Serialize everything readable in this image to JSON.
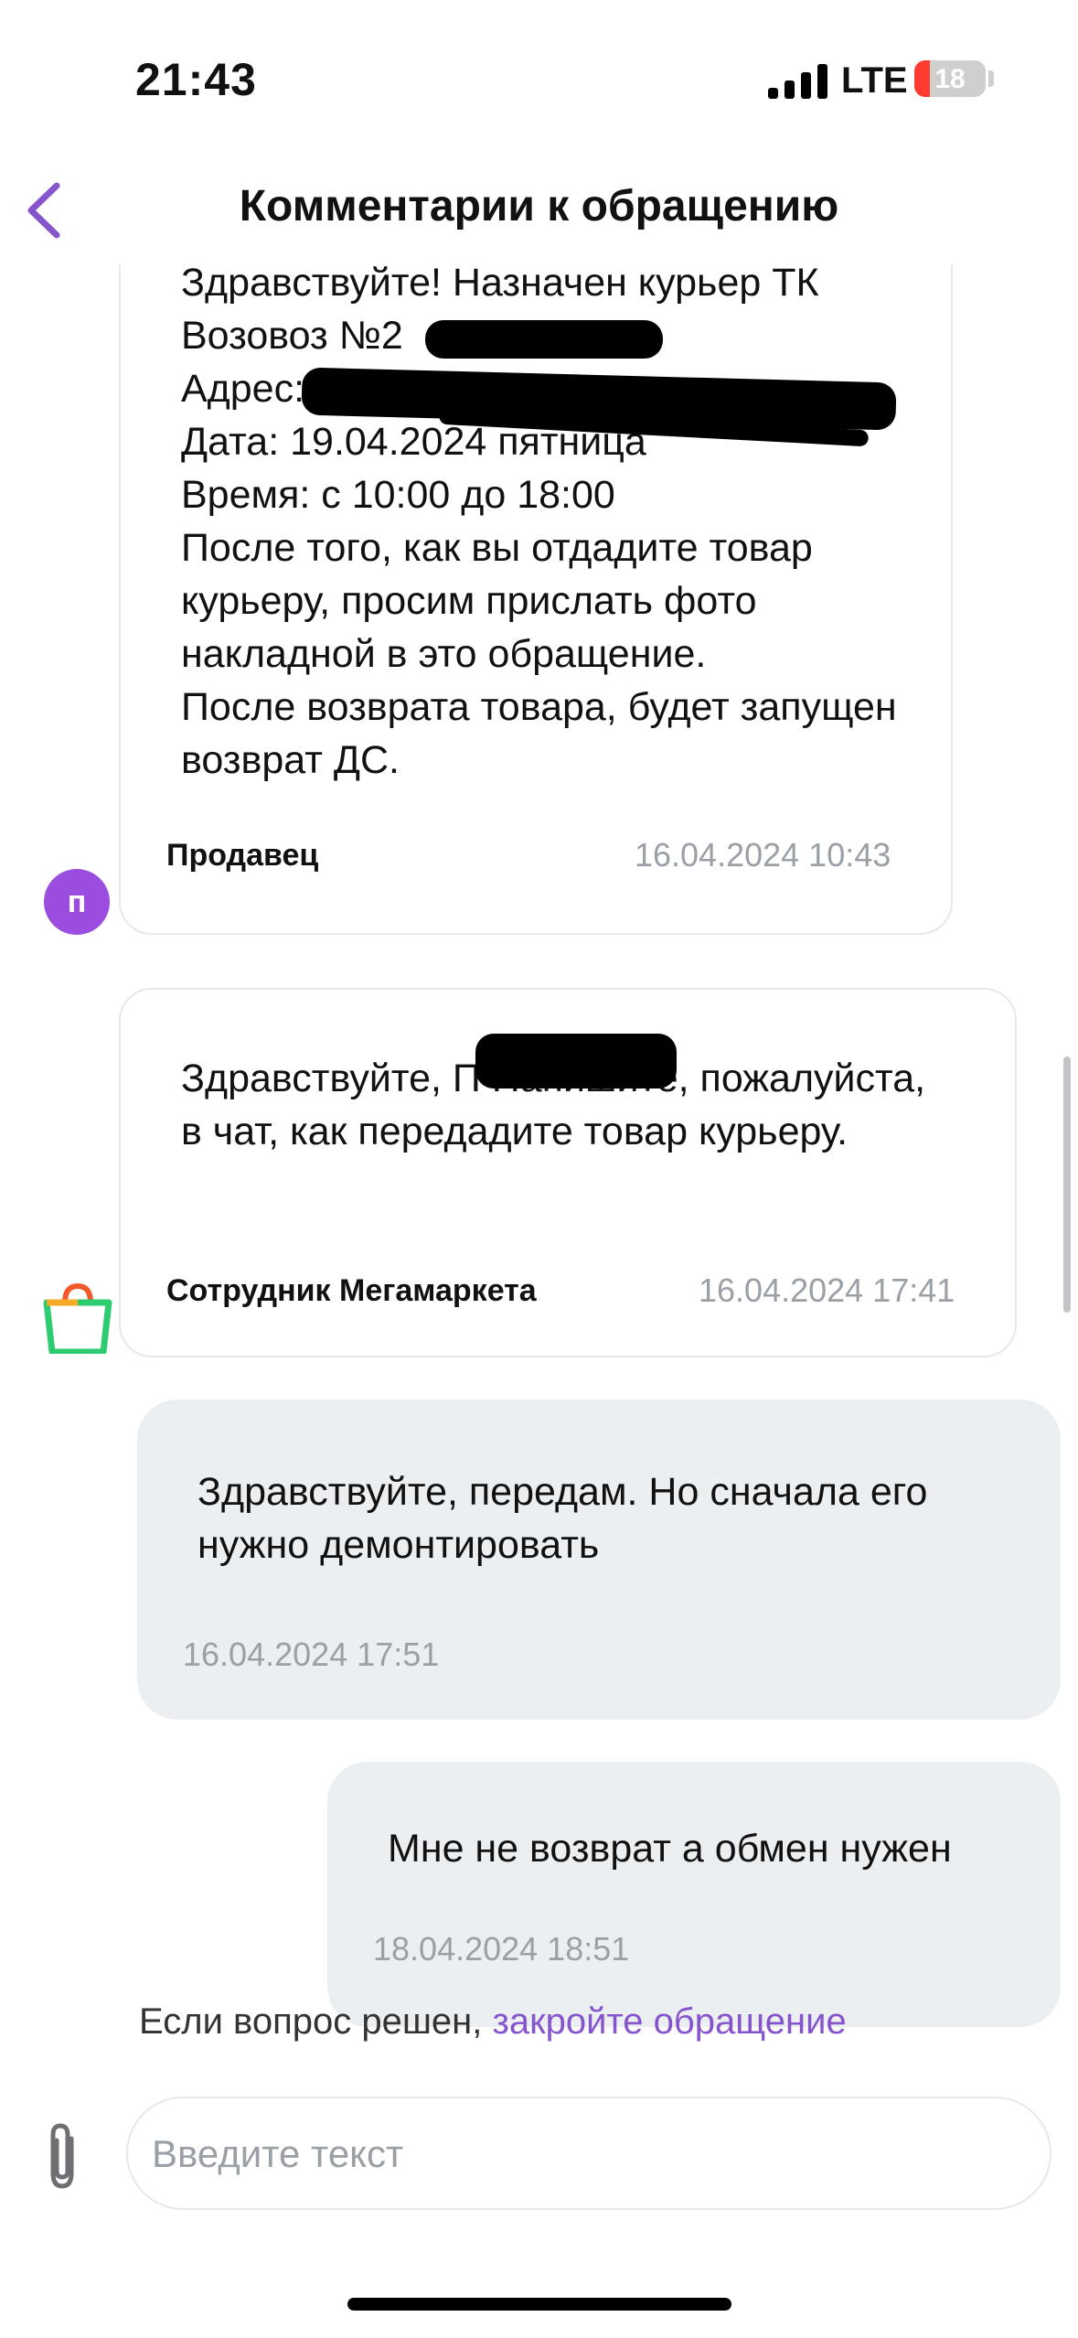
{
  "status_bar": {
    "time": "21:43",
    "network": "LTE",
    "battery": "18",
    "signal_icon": "signal-bars-icon"
  },
  "header": {
    "title": "Комментарии к обращению",
    "back_icon": "chevron-left-icon"
  },
  "colors": {
    "accent": "#8654cc",
    "avatar_seller": "#9b4de0",
    "outgoing_bubble": "#eceff1",
    "timestamp": "#9aa0a6"
  },
  "messages": [
    {
      "direction": "incoming",
      "text": "Здравствуйте! Назначен курьер ТК\nВозовоз №2\nАдрес: К\nДата: 19.04.2024 пятница\nВремя: с 10:00 до 18:00\nПосле того, как вы отдадите товар курьеру, просим прислать фото накладной в это обращение.\nПосле возврата товара, будет запущен возврат ДС.",
      "sender": "Продавец",
      "avatar_letter": "п",
      "timestamp": "16.04.2024 10:43"
    },
    {
      "direction": "incoming",
      "text": "Здравствуйте, П Напишите, пожалуйста, в чат, как передадите товар курьеру.",
      "sender": "Сотрудник Мегамаркета",
      "avatar_icon": "megamarket-bag-icon",
      "timestamp": "16.04.2024 17:41"
    },
    {
      "direction": "outgoing",
      "text": "Здравствуйте, передам. Но сначала его нужно демонтировать",
      "timestamp": "16.04.2024 17:51"
    },
    {
      "direction": "outgoing",
      "text": "Мне не возврат а обмен нужен",
      "timestamp": "18.04.2024 18:51"
    }
  ],
  "resolve": {
    "prefix": "Если вопрос решен,",
    "link": "закройте обращение"
  },
  "composer": {
    "placeholder": "Введите текст",
    "value": "",
    "attach_icon": "paperclip-icon"
  }
}
